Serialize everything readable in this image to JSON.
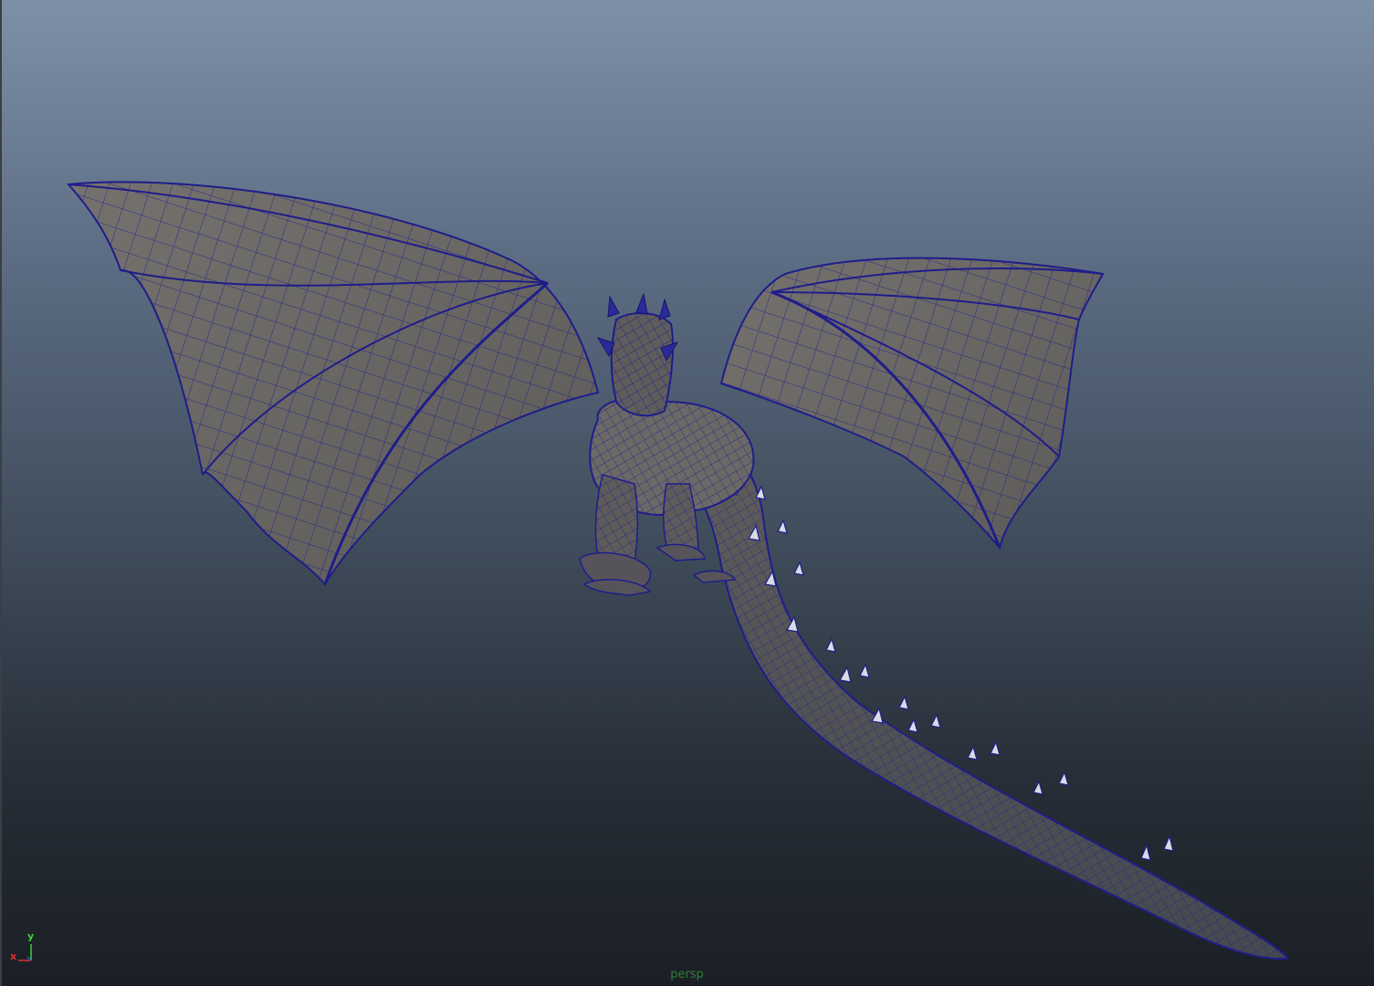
{
  "viewport": {
    "camera_name": "persp",
    "camera_color": "#2e7d3a",
    "background_top": "#7e90a8",
    "background_bottom": "#1b1f25",
    "mesh_fill": "#6a6866",
    "wire_color": "#1f1d8a"
  },
  "axis_gizmo": {
    "y_label": "y",
    "x_label": "x",
    "y_color": "#39d13a",
    "x_color": "#e03030",
    "z_color": "#3050e0"
  },
  "model": {
    "icon": "dragon-wireframe-mesh"
  }
}
